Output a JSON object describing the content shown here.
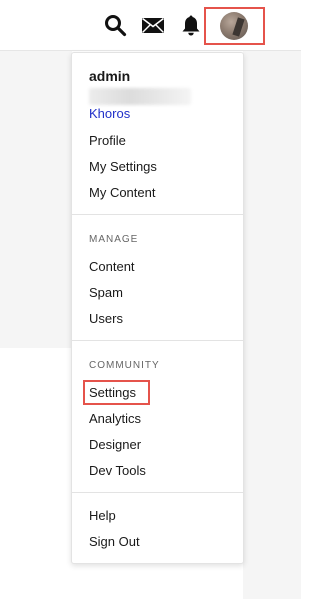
{
  "header": {
    "icons": [
      "search-icon",
      "mail-icon",
      "bell-icon"
    ],
    "avatar_label": "User avatar"
  },
  "menu": {
    "username": "admin",
    "org_link": "Khoros",
    "profile": "Profile",
    "my_settings": "My Settings",
    "my_content": "My Content",
    "manage_heading": "MANAGE",
    "content": "Content",
    "spam": "Spam",
    "users": "Users",
    "community_heading": "COMMUNITY",
    "settings": "Settings",
    "analytics": "Analytics",
    "designer": "Designer",
    "dev_tools": "Dev Tools",
    "help": "Help",
    "sign_out": "Sign Out"
  },
  "colors": {
    "highlight": "#e5534b",
    "link": "#2130c9"
  }
}
